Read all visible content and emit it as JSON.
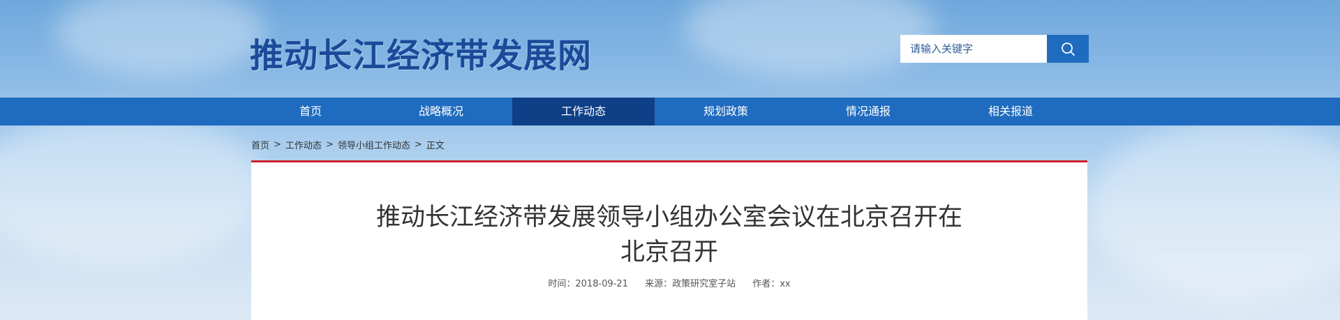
{
  "site": {
    "title": "推动长江经济带发展网"
  },
  "search": {
    "placeholder": "请输入关键字",
    "button_icon": "search-icon"
  },
  "nav": {
    "items": [
      {
        "label": "首页"
      },
      {
        "label": "战略概况"
      },
      {
        "label": "工作动态",
        "active": true
      },
      {
        "label": "规划政策"
      },
      {
        "label": "情况通报"
      },
      {
        "label": "相关报道"
      }
    ]
  },
  "breadcrumb": {
    "items": [
      "首页",
      "工作动态",
      "领导小组工作动态",
      "正文"
    ],
    "separator": ">"
  },
  "article": {
    "title_line1": "推动长江经济带发展领导小组办公室会议在北京召开在",
    "title_line2": "北京召开",
    "date": "时间：2018-09-21",
    "source": "来源：政策研究室子站",
    "author": "作者：xx"
  },
  "colors": {
    "nav_bg": "#1f6bbf",
    "nav_active": "#0f3f87",
    "title_blue": "#1a4a99",
    "accent_red": "#cc1f2d"
  }
}
